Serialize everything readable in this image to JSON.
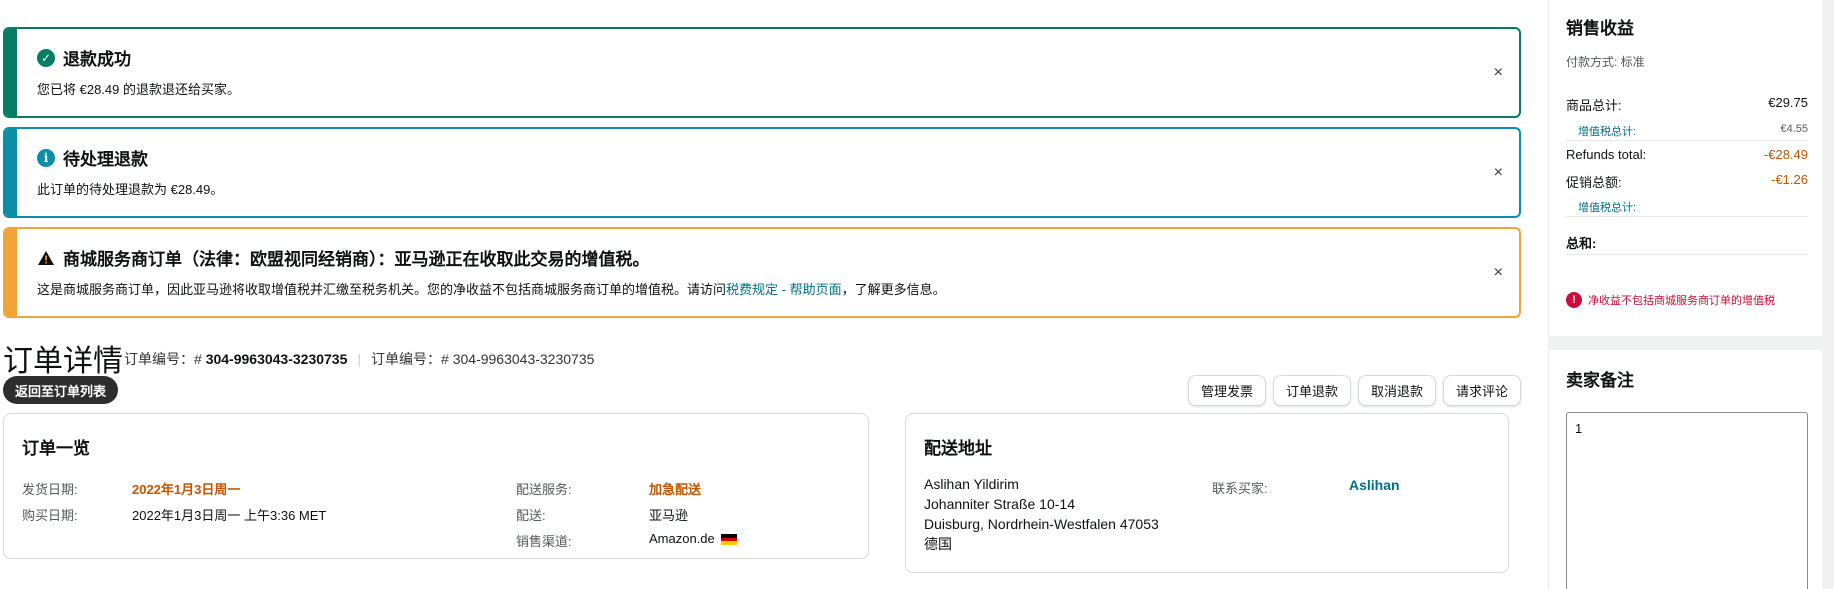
{
  "alerts": {
    "success": {
      "title": "退款成功",
      "message": "您已将 €28.49 的退款退还给买家。"
    },
    "info": {
      "title": "待处理退款",
      "message": "此订单的待处理退款为 €28.49。"
    },
    "warn": {
      "title": "商城服务商订单（法律：欧盟视同经销商）：亚马逊正在收取此交易的增值税。",
      "message_before": "这是商城服务商订单，因此亚马逊将收取增值税并汇缴至税务机关。您的净收益不包括商城服务商订单的增值税。请访问",
      "link": "税费规定 - 帮助页面",
      "message_after": "，了解更多信息。"
    },
    "close_glyph": "×"
  },
  "header": {
    "title": "订单详情",
    "order_id_label_1": "订单编号：#",
    "order_id_1": "304-9963043-3230735",
    "order_id_label_2": "订单编号：# 304-9963043-3230735",
    "back_button": "返回至订单列表",
    "actions": [
      "管理发票",
      "订单退款",
      "取消退款",
      "请求评论"
    ]
  },
  "overview": {
    "title": "订单一览",
    "ship_date_label": "发货日期:",
    "ship_date": "2022年1月3日周一",
    "purchase_date_label": "购买日期:",
    "purchase_date": "2022年1月3日周一 上午3:36 MET",
    "shipping_service_label": "配送服务:",
    "shipping_service": "加急配送",
    "fulfillment_label": "配送:",
    "fulfillment": "亚马逊",
    "channel_label": "销售渠道:",
    "channel": "Amazon.de"
  },
  "shipping": {
    "title": "配送地址",
    "name": "Aslihan Yildirim",
    "street": "Johanniter Straße 10-14",
    "city": "Duisburg, Nordrhein-Westfalen 47053",
    "country": "德国",
    "contact_label": "联系买家:",
    "contact_name": "Aslihan"
  },
  "revenue": {
    "title": "销售收益",
    "payment_method": "付款方式: 标准",
    "items_total_label": "商品总计:",
    "items_total": "€29.75",
    "vat_total_label": "增值税总计:",
    "vat_total": "€4.55",
    "refunds_label": "Refunds total:",
    "refunds": "-€28.49",
    "promo_label": "促销总额:",
    "promo": "-€1.26",
    "vat_total_label_2": "增值税总计:",
    "sum_label": "总和:",
    "notice": "净收益不包括商城服务商订单的增值税"
  },
  "notes": {
    "title": "卖家备注",
    "value": "1"
  },
  "colors": {
    "success": "#067d62",
    "info": "#0a8fa6",
    "warning": "#f0a43a",
    "link": "#007185",
    "accent_orange": "#c45500",
    "error": "#cc0c39"
  }
}
